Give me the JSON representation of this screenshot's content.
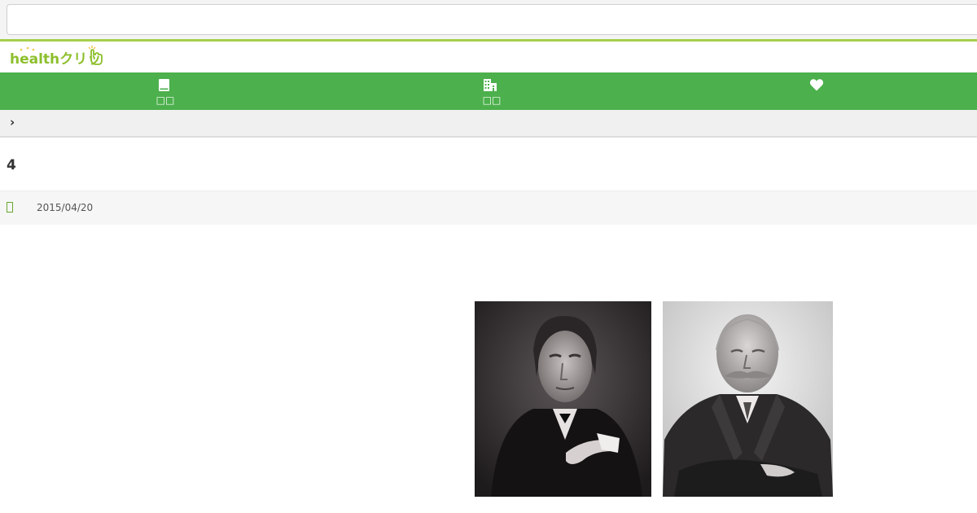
{
  "header": {
    "url": "",
    "logo": {
      "text": "healthクリック",
      "colors": {
        "text": "#8dbf2c",
        "accent": "#f2c94c",
        "hand": "#8dbf2c"
      }
    }
  },
  "nav": {
    "background": "#4cb04c",
    "items": [
      {
        "icon": "book-icon",
        "label": "□□"
      },
      {
        "icon": "building-icon",
        "label": "□□"
      },
      {
        "icon": "heart-icon",
        "label": ""
      }
    ]
  },
  "breadcrumb": {
    "separator": "›"
  },
  "article": {
    "title": "4",
    "date_icon": "calendar-icon",
    "date": "2015/04/20",
    "images": [
      {
        "name": "portrait-1",
        "description_icon": "portrait-photo"
      },
      {
        "name": "portrait-2",
        "description_icon": "portrait-photo"
      }
    ]
  },
  "colors": {
    "brand_green": "#4cb04c",
    "logo_green": "#8dbf2c",
    "rule_green": "#a5cf4c"
  }
}
